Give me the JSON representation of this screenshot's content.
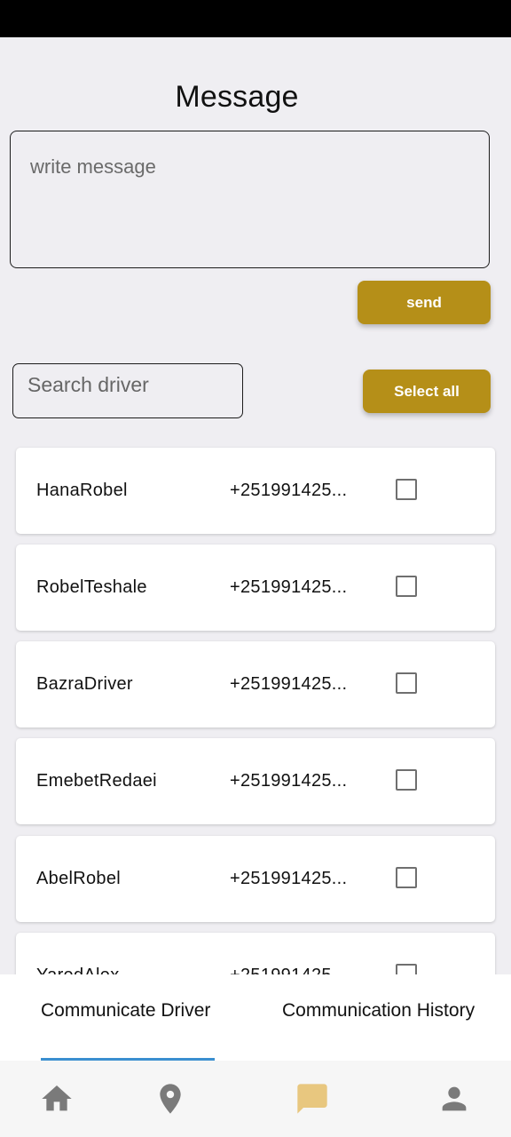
{
  "page": {
    "title": "Message"
  },
  "message": {
    "placeholder": "write message"
  },
  "send_label": "send",
  "search": {
    "placeholder": "Search driver"
  },
  "select_all_label": "Select all",
  "drivers": [
    {
      "name": "HanaRobel",
      "phone": "+251991425...",
      "checked": false
    },
    {
      "name": "RobelTeshale",
      "phone": "+251991425...",
      "checked": false
    },
    {
      "name": "BazraDriver",
      "phone": "+251991425...",
      "checked": false
    },
    {
      "name": "EmebetRedaei",
      "phone": "+251991425...",
      "checked": false
    },
    {
      "name": "AbelRobel",
      "phone": "+251991425...",
      "checked": false
    },
    {
      "name": "YaredAlex",
      "phone": "+251991425...",
      "checked": false
    }
  ],
  "tabs": [
    {
      "label": "Communicate Driver",
      "active": true
    },
    {
      "label": "Communication History",
      "active": false
    }
  ],
  "bottom_nav": [
    {
      "icon": "home-icon",
      "active": false
    },
    {
      "icon": "location-pin-icon",
      "active": false
    },
    {
      "icon": "chat-icon",
      "active": true
    },
    {
      "icon": "person-icon",
      "active": false
    }
  ],
  "colors": {
    "accent_gold": "#b58f18",
    "tab_indicator": "#3a8fd0",
    "inactive_icon": "#7a7a7a",
    "active_icon": "#e8c77f",
    "background": "#efeef2"
  }
}
